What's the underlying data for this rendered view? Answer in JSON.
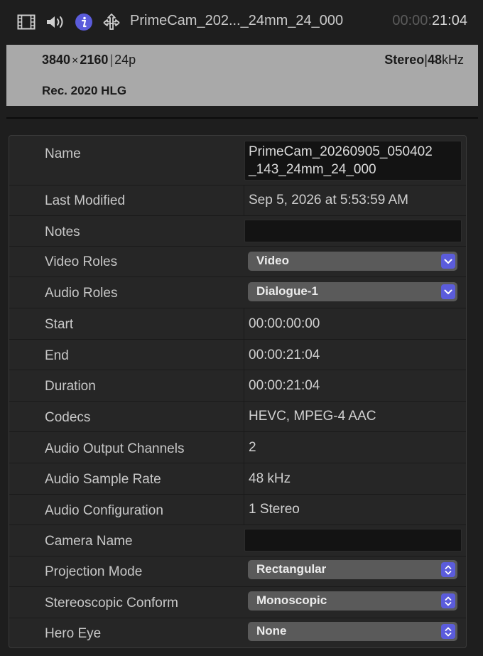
{
  "toolbar": {
    "title": "PrimeCam_202..._24mm_24_000",
    "timecode_dim": "00:00:",
    "timecode_lit": "21:04",
    "icons": [
      "film-icon",
      "speaker-icon",
      "info-icon",
      "share-icon"
    ],
    "accent_color": "#5b5cdb"
  },
  "info": {
    "resolution_w": "3840",
    "resolution_x": "×",
    "resolution_h": "2160",
    "frame_rate": "24p",
    "audio_channels": "Stereo",
    "sample_rate_num": "48",
    "sample_rate_unit": "kHz",
    "color_space": "Rec. 2020 HLG"
  },
  "inspector": {
    "name_label": "Name",
    "name_line1": "PrimeCam_20260905_050402",
    "name_line2": "_143_24mm_24_000",
    "last_modified_label": "Last Modified",
    "last_modified_value": "Sep 5, 2026 at 5:53:59 AM",
    "notes_label": "Notes",
    "notes_value": "",
    "video_roles_label": "Video Roles",
    "video_roles_value": "Video",
    "audio_roles_label": "Audio Roles",
    "audio_roles_value": "Dialogue-1",
    "start_label": "Start",
    "start_value": "00:00:00:00",
    "end_label": "End",
    "end_value": "00:00:21:04",
    "duration_label": "Duration",
    "duration_value": "00:00:21:04",
    "codecs_label": "Codecs",
    "codecs_value": "HEVC, MPEG-4 AAC",
    "audio_output_channels_label": "Audio Output Channels",
    "audio_output_channels_value": "2",
    "audio_sample_rate_label": "Audio Sample Rate",
    "audio_sample_rate_value": "48 kHz",
    "audio_configuration_label": "Audio Configuration",
    "audio_configuration_value": "1 Stereo",
    "camera_name_label": "Camera Name",
    "camera_name_value": "",
    "projection_mode_label": "Projection Mode",
    "projection_mode_value": "Rectangular",
    "stereoscopic_conform_label": "Stereoscopic Conform",
    "stereoscopic_conform_value": "Monoscopic",
    "hero_eye_label": "Hero Eye",
    "hero_eye_value": "None"
  }
}
